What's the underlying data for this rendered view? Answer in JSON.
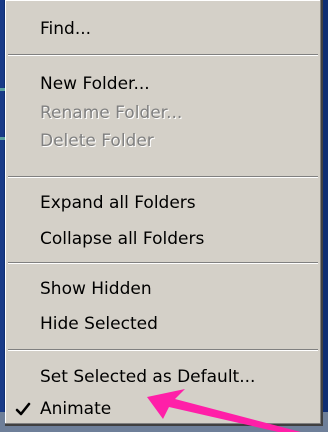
{
  "menu": {
    "items": [
      {
        "label": "Find...",
        "enabled": true
      },
      {
        "label": "New Folder...",
        "enabled": true
      },
      {
        "label": "Rename Folder...",
        "enabled": false
      },
      {
        "label": "Delete Folder",
        "enabled": false
      },
      {
        "label": "Expand all Folders",
        "enabled": true
      },
      {
        "label": "Collapse all Folders",
        "enabled": true
      },
      {
        "label": "Show Hidden",
        "enabled": true
      },
      {
        "label": "Hide Selected",
        "enabled": true
      },
      {
        "label": "Set Selected as Default...",
        "enabled": true
      },
      {
        "label": "Animate",
        "enabled": true,
        "checked": true
      }
    ]
  },
  "colors": {
    "menu_bg": "#d4d0c8",
    "disabled_text": "#808080",
    "arrow": "#ff1fa8",
    "desktop": "#0f2e73"
  },
  "icons": {
    "check": "checkmark-icon",
    "pointer": "pink-arrow-pointer"
  }
}
